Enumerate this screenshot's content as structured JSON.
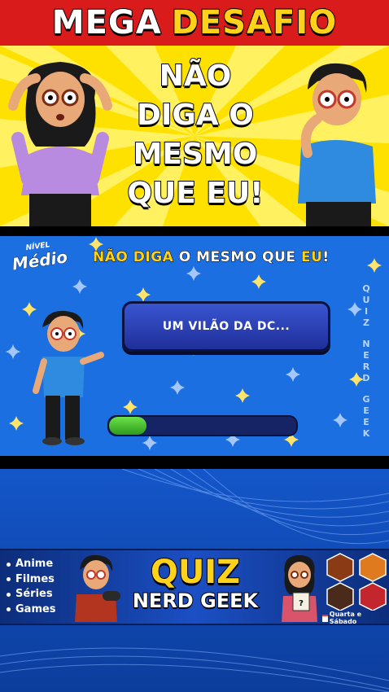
{
  "header": {
    "word1": "MEGA",
    "word2": "DESAFIO"
  },
  "hero": {
    "lines": [
      "NÃO",
      "DIGA O",
      "MESMO",
      "QUE EU!"
    ]
  },
  "game": {
    "level_small": "NÍVEL",
    "level_big": "Médio",
    "title_parts": [
      "NÃO",
      "DIGA",
      "O MESMO QUE",
      "EU",
      "!"
    ],
    "answer": "UM VILÃO DA DC...",
    "progress": 0.2,
    "side_text": [
      "Q",
      "U",
      "I",
      "Z",
      "N",
      "E",
      "R",
      "D",
      "G",
      "E",
      "E",
      "K"
    ]
  },
  "banner": {
    "topics": [
      "Anime",
      "Filmes",
      "Séries",
      "Games"
    ],
    "logo_quiz": "QUIZ",
    "logo_nerd": "NERD GEEK",
    "schedule": "Quarta e Sábado"
  },
  "colors": {
    "red": "#d91b1b",
    "yellow": "#ffe100",
    "blue": "#1b6fe0",
    "accent_yellow": "#ffd21a"
  }
}
